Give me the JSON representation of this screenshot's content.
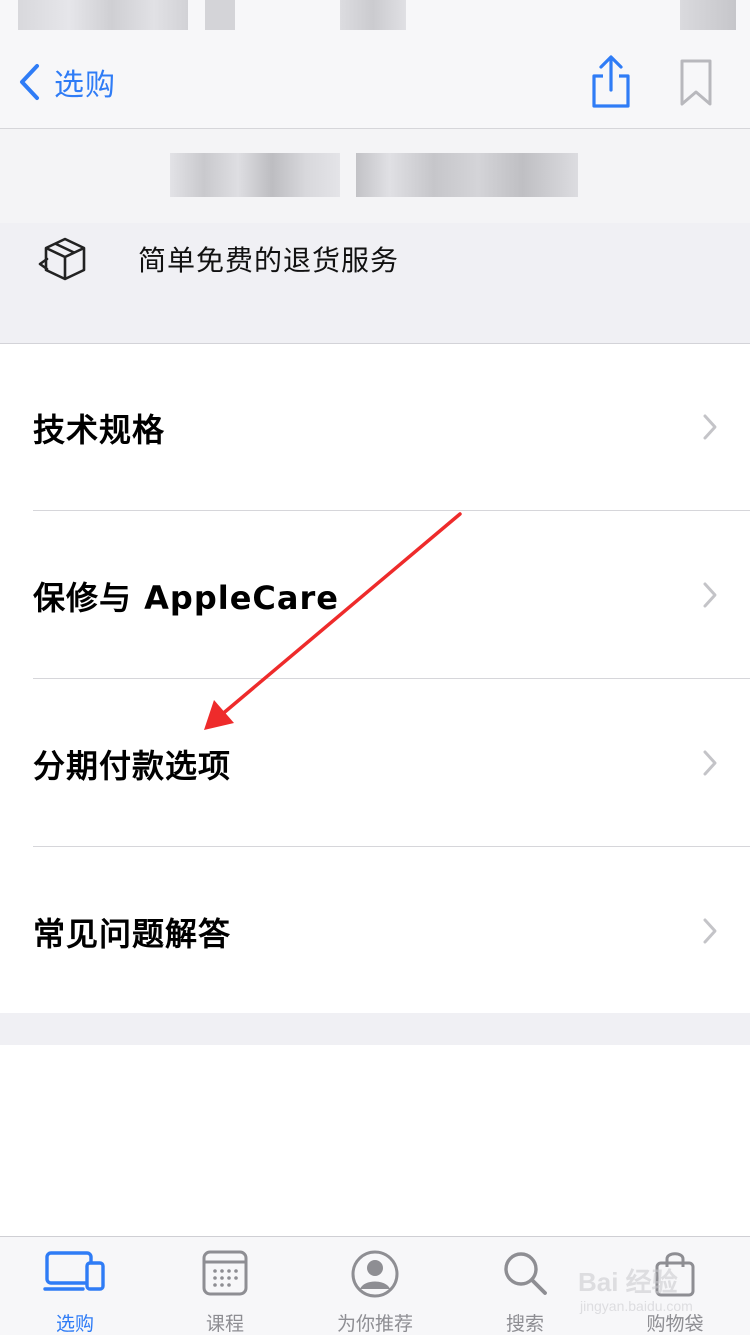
{
  "nav": {
    "back_label": "选购"
  },
  "return_service": {
    "text": "简单免费的退货服务"
  },
  "list": {
    "items": [
      {
        "label": "技术规格"
      },
      {
        "label": "保修与 AppleCare"
      },
      {
        "label": "分期付款选项"
      },
      {
        "label": "常见问题解答"
      }
    ]
  },
  "tabs": [
    {
      "label": "选购",
      "icon": "devices-icon",
      "active": true
    },
    {
      "label": "课程",
      "icon": "calendar-icon",
      "active": false
    },
    {
      "label": "为你推荐",
      "icon": "person-icon",
      "active": false
    },
    {
      "label": "搜索",
      "icon": "search-icon",
      "active": false
    },
    {
      "label": "购物袋",
      "icon": "bag-icon",
      "active": false
    }
  ],
  "watermark": {
    "main": "Bai 经验",
    "sub": "jingyan.baidu.com"
  },
  "colors": {
    "accent": "#2f7cf6",
    "annotation": "#ee2b2b",
    "chevron": "#c4c4c8"
  }
}
